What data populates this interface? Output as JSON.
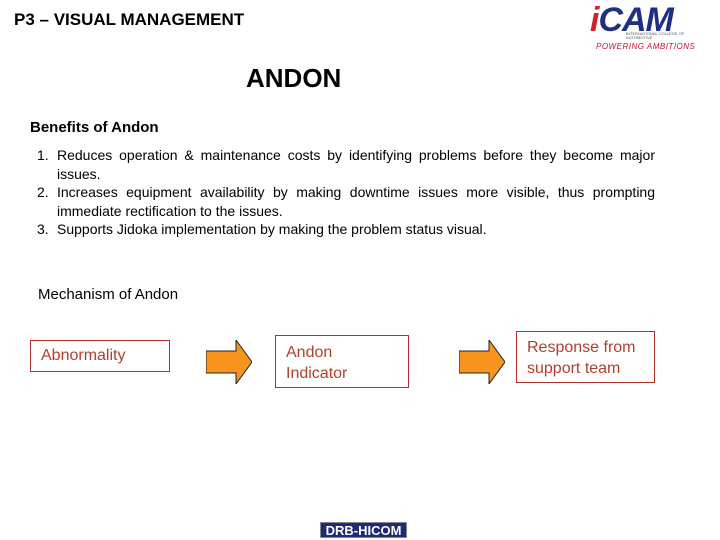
{
  "header": {
    "title": "P3 – VISUAL MANAGEMENT"
  },
  "logo": {
    "brand": "iCAM",
    "brand_i": "i",
    "brand_rest": "CAM",
    "subtitle": "INTERNATIONAL COLLEGE OF AUTOMOTIVE",
    "tagline": "POWERING AMBITIONS"
  },
  "main_title": "ANDON",
  "benefits": {
    "heading": "Benefits of Andon",
    "items": [
      {
        "num": "1.",
        "text": "Reduces operation & maintenance costs by identifying problems before they become major issues."
      },
      {
        "num": "2.",
        "text": "Increases equipment availability by making downtime issues more visible, thus prompting immediate rectification to the issues."
      },
      {
        "num": "3.",
        "text": "Supports Jidoka implementation by making the problem status visual."
      }
    ]
  },
  "mechanism": {
    "heading": "Mechanism of Andon",
    "steps": [
      "Abnormality",
      "Andon Indicator",
      "Response from support team"
    ],
    "arrow_color": "#f7941d",
    "box_border_color": "#b03030",
    "box_text_color": "#b0402a"
  },
  "footer": {
    "logo_text": "DRB-HICOM"
  }
}
